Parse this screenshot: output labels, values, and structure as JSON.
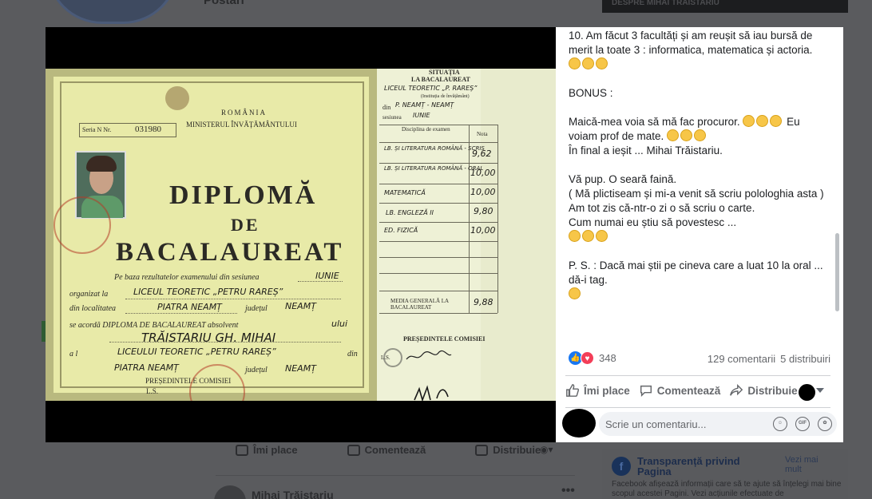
{
  "background": {
    "author_top": "Postări",
    "right_header": "DESPRE MIHAI TRĂISTARIU",
    "actions": {
      "like": "Îmi place",
      "comment": "Comentează",
      "share": "Distribuie"
    },
    "post_author": "Mihai Trăistariu",
    "transparency": {
      "title": "Transparență privind Pagina",
      "more": "Vezi mai mult",
      "description": "Facebook afișează informații care să te ajute să înțelegi mai bine scopul acestei Pagini. Vezi acțiunile efectuate de"
    }
  },
  "photo": {
    "header_title": "SITUAȚIA",
    "header_subtitle": "LA BACALAUREAT",
    "country": "ROMÂNIA",
    "ministry": "MINISTERUL ÎNVĂȚĂMÂNTULUI",
    "series_label": "Seria N Nr.",
    "series_number": "031980",
    "title_1": "DIPLOMĂ",
    "title_2": "DE",
    "title_3": "BACALAUREAT",
    "session_text": "Pe baza rezultatelor examenului din sesiunea",
    "session_value": "IUNIE",
    "organized_text": "organizat la",
    "organized_value": "LICEUL TEORETIC „PETRU RAREȘ”",
    "locality_text": "din localitatea",
    "locality_value": "PIATRA NEAMȚ",
    "county_text": "județul",
    "county_value": "NEAMȚ",
    "granted_text": "se acordă DIPLOMA DE BACALAUREAT absolvent",
    "granted_value": "ului",
    "name_value": "TRĂISTARIU GH. MIHAI",
    "school_value": "LICEULUI TEORETIC „PETRU RAREȘ”",
    "school_prefix": "a l",
    "din_text": "din",
    "locality2_value": "PIATRA NEAMȚ",
    "county2_value": "NEAMȚ",
    "president": "PREȘEDINTELE COMISIEI",
    "ls": "L.S.",
    "right_school": "LICEUL TEORETIC „P. RAREȘ”",
    "right_institution": "(Instituția de învățământ)",
    "right_din": "din",
    "right_locality": "P. NEAMȚ - NEAMȚ",
    "right_session_label": "sesiunea",
    "right_session_value": "IUNIE",
    "subject_header": "Disciplina de examen",
    "grade_header": "Nota",
    "subjects": [
      {
        "name": "LB. ȘI LITERATURA ROMÂNĂ - SCRIS",
        "grade": "9,62"
      },
      {
        "name": "LB. ȘI LITERATURA ROMÂNĂ - ORAL",
        "grade": "10,00"
      },
      {
        "name": "MATEMATICĂ",
        "grade": "10,00"
      },
      {
        "name": "LB. ENGLEZĂ II",
        "grade": "9,80"
      },
      {
        "name": "ED. FIZICĂ",
        "grade": "10,00"
      }
    ],
    "average_label": "MEDIA GENERALĂ LA BACALAUREAT",
    "average_value": "9,88",
    "right_president": "PREȘEDINTELE COMISIEI",
    "right_ls": "L.S."
  },
  "panel": {
    "paragraph_1": "10. Am făcut 3 facultăți și am reușit să iau bursă de merit la toate 3 : informatica, matematica și actoria.",
    "bonus": "BONUS :",
    "paragraph_2a": "Maică-mea voia să mă fac procuror.",
    "paragraph_2b": "Eu voiam prof de mate.",
    "paragraph_2c": "În final a ieșit ... Mihai Trăistariu.",
    "paragraph_3a": "Vă pup. O seară faină.",
    "paragraph_3b": "( Mă plictiseam și mi-a venit să scriu polologhia asta )",
    "paragraph_3c": "Am tot zis că-ntr-o zi o să scriu o carte.",
    "paragraph_3d": "Cum numai eu știu să povestesc ...",
    "paragraph_4": "P. S. : Dacă mai știi pe cineva care a luat 10 la oral ... dă-i tag.",
    "reaction_count": "348",
    "comments_count": "129 comentarii",
    "shares_count": "5 distribuiri",
    "like_label": "Îmi place",
    "comment_label": "Comentează",
    "share_label": "Distribuie",
    "comment_placeholder": "Scrie un comentariu..."
  },
  "colors": {
    "accent": "#1877f2",
    "love": "#f33e58",
    "muted_text": "#65676b"
  }
}
